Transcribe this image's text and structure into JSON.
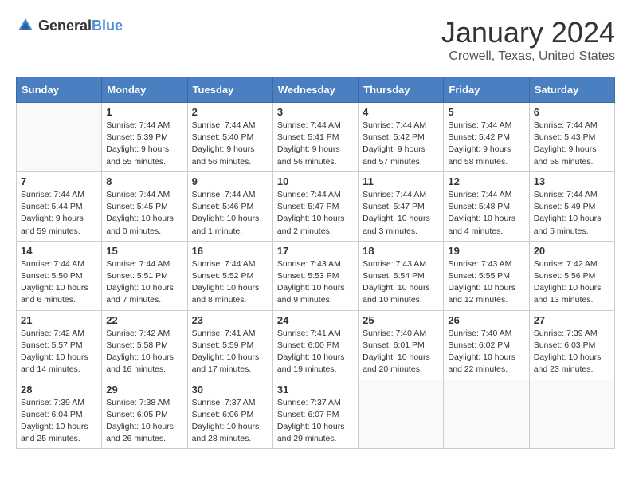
{
  "header": {
    "logo_general": "General",
    "logo_blue": "Blue",
    "month": "January 2024",
    "location": "Crowell, Texas, United States"
  },
  "weekdays": [
    "Sunday",
    "Monday",
    "Tuesday",
    "Wednesday",
    "Thursday",
    "Friday",
    "Saturday"
  ],
  "weeks": [
    [
      {
        "day": "",
        "info": ""
      },
      {
        "day": "1",
        "info": "Sunrise: 7:44 AM\nSunset: 5:39 PM\nDaylight: 9 hours\nand 55 minutes."
      },
      {
        "day": "2",
        "info": "Sunrise: 7:44 AM\nSunset: 5:40 PM\nDaylight: 9 hours\nand 56 minutes."
      },
      {
        "day": "3",
        "info": "Sunrise: 7:44 AM\nSunset: 5:41 PM\nDaylight: 9 hours\nand 56 minutes."
      },
      {
        "day": "4",
        "info": "Sunrise: 7:44 AM\nSunset: 5:42 PM\nDaylight: 9 hours\nand 57 minutes."
      },
      {
        "day": "5",
        "info": "Sunrise: 7:44 AM\nSunset: 5:42 PM\nDaylight: 9 hours\nand 58 minutes."
      },
      {
        "day": "6",
        "info": "Sunrise: 7:44 AM\nSunset: 5:43 PM\nDaylight: 9 hours\nand 58 minutes."
      }
    ],
    [
      {
        "day": "7",
        "info": "Sunrise: 7:44 AM\nSunset: 5:44 PM\nDaylight: 9 hours\nand 59 minutes."
      },
      {
        "day": "8",
        "info": "Sunrise: 7:44 AM\nSunset: 5:45 PM\nDaylight: 10 hours\nand 0 minutes."
      },
      {
        "day": "9",
        "info": "Sunrise: 7:44 AM\nSunset: 5:46 PM\nDaylight: 10 hours\nand 1 minute."
      },
      {
        "day": "10",
        "info": "Sunrise: 7:44 AM\nSunset: 5:47 PM\nDaylight: 10 hours\nand 2 minutes."
      },
      {
        "day": "11",
        "info": "Sunrise: 7:44 AM\nSunset: 5:47 PM\nDaylight: 10 hours\nand 3 minutes."
      },
      {
        "day": "12",
        "info": "Sunrise: 7:44 AM\nSunset: 5:48 PM\nDaylight: 10 hours\nand 4 minutes."
      },
      {
        "day": "13",
        "info": "Sunrise: 7:44 AM\nSunset: 5:49 PM\nDaylight: 10 hours\nand 5 minutes."
      }
    ],
    [
      {
        "day": "14",
        "info": "Sunrise: 7:44 AM\nSunset: 5:50 PM\nDaylight: 10 hours\nand 6 minutes."
      },
      {
        "day": "15",
        "info": "Sunrise: 7:44 AM\nSunset: 5:51 PM\nDaylight: 10 hours\nand 7 minutes."
      },
      {
        "day": "16",
        "info": "Sunrise: 7:44 AM\nSunset: 5:52 PM\nDaylight: 10 hours\nand 8 minutes."
      },
      {
        "day": "17",
        "info": "Sunrise: 7:43 AM\nSunset: 5:53 PM\nDaylight: 10 hours\nand 9 minutes."
      },
      {
        "day": "18",
        "info": "Sunrise: 7:43 AM\nSunset: 5:54 PM\nDaylight: 10 hours\nand 10 minutes."
      },
      {
        "day": "19",
        "info": "Sunrise: 7:43 AM\nSunset: 5:55 PM\nDaylight: 10 hours\nand 12 minutes."
      },
      {
        "day": "20",
        "info": "Sunrise: 7:42 AM\nSunset: 5:56 PM\nDaylight: 10 hours\nand 13 minutes."
      }
    ],
    [
      {
        "day": "21",
        "info": "Sunrise: 7:42 AM\nSunset: 5:57 PM\nDaylight: 10 hours\nand 14 minutes."
      },
      {
        "day": "22",
        "info": "Sunrise: 7:42 AM\nSunset: 5:58 PM\nDaylight: 10 hours\nand 16 minutes."
      },
      {
        "day": "23",
        "info": "Sunrise: 7:41 AM\nSunset: 5:59 PM\nDaylight: 10 hours\nand 17 minutes."
      },
      {
        "day": "24",
        "info": "Sunrise: 7:41 AM\nSunset: 6:00 PM\nDaylight: 10 hours\nand 19 minutes."
      },
      {
        "day": "25",
        "info": "Sunrise: 7:40 AM\nSunset: 6:01 PM\nDaylight: 10 hours\nand 20 minutes."
      },
      {
        "day": "26",
        "info": "Sunrise: 7:40 AM\nSunset: 6:02 PM\nDaylight: 10 hours\nand 22 minutes."
      },
      {
        "day": "27",
        "info": "Sunrise: 7:39 AM\nSunset: 6:03 PM\nDaylight: 10 hours\nand 23 minutes."
      }
    ],
    [
      {
        "day": "28",
        "info": "Sunrise: 7:39 AM\nSunset: 6:04 PM\nDaylight: 10 hours\nand 25 minutes."
      },
      {
        "day": "29",
        "info": "Sunrise: 7:38 AM\nSunset: 6:05 PM\nDaylight: 10 hours\nand 26 minutes."
      },
      {
        "day": "30",
        "info": "Sunrise: 7:37 AM\nSunset: 6:06 PM\nDaylight: 10 hours\nand 28 minutes."
      },
      {
        "day": "31",
        "info": "Sunrise: 7:37 AM\nSunset: 6:07 PM\nDaylight: 10 hours\nand 29 minutes."
      },
      {
        "day": "",
        "info": ""
      },
      {
        "day": "",
        "info": ""
      },
      {
        "day": "",
        "info": ""
      }
    ]
  ]
}
